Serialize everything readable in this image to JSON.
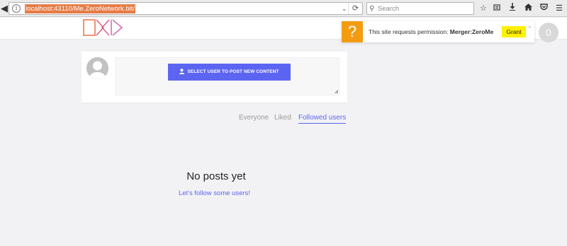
{
  "browser": {
    "url": "localhost:43110/Me.ZeroNetwork.bit/",
    "search_placeholder": "Search",
    "icons": [
      "back-icon",
      "info-icon",
      "url-dropdown-icon",
      "reload-icon",
      "search-icon",
      "bookmark-star-icon",
      "reading-list-icon",
      "download-icon",
      "home-icon",
      "pocket-icon",
      "menu-icon"
    ]
  },
  "site": {
    "logo_icon": "zeronet-me-logo",
    "accent_color": "#5c65f2"
  },
  "notification": {
    "icon": "?",
    "text": "This site requests permission: ",
    "permission": "Merger:ZeroMe",
    "grant_label": "Grant",
    "close_label": "×",
    "count": "0"
  },
  "composer": {
    "select_user_label": "SELECT USER TO POST NEW CONTENT"
  },
  "feed": {
    "tabs": [
      {
        "label": "Everyone",
        "active": false
      },
      {
        "label": "Liked",
        "active": false
      },
      {
        "label": "Followed users",
        "active": true
      }
    ],
    "empty_title": "No posts yet",
    "empty_link": "Let's follow some users!"
  }
}
